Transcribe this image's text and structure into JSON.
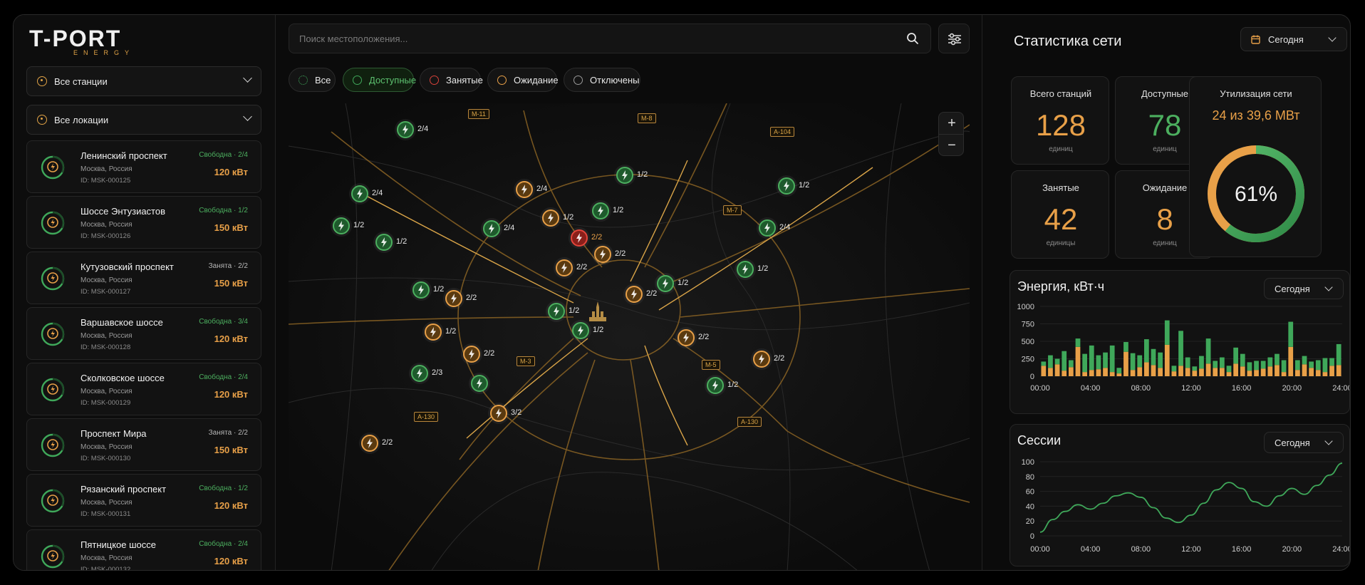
{
  "brand": {
    "name": "T-PORT",
    "sub": "ENERGY"
  },
  "filters": {
    "stations_dropdown": "Все станции",
    "locations_dropdown": "Все локации"
  },
  "stations": [
    {
      "name": "Ленинский проспект",
      "location": "Москва, Россия",
      "id": "ID: MSK-000125",
      "status": "Свободна · 2/4",
      "status_type": "free",
      "power": "120 кВт"
    },
    {
      "name": "Шоссе Энтузиастов",
      "location": "Москва, Россия",
      "id": "ID: MSK-000126",
      "status": "Свободна · 1/2",
      "status_type": "free",
      "power": "150 кВт"
    },
    {
      "name": "Кутузовский проспект",
      "location": "Москва, Россия",
      "id": "ID: MSK-000127",
      "status": "Занята · 2/2",
      "status_type": "busy",
      "power": "150 кВт"
    },
    {
      "name": "Варшавское шоссе",
      "location": "Москва, Россия",
      "id": "ID: MSK-000128",
      "status": "Свободна · 3/4",
      "status_type": "free",
      "power": "120 кВт"
    },
    {
      "name": "Сколковское шоссе",
      "location": "Москва, Россия",
      "id": "ID: MSK-000129",
      "status": "Свободна · 2/4",
      "status_type": "free",
      "power": "120 кВт"
    },
    {
      "name": "Проспект Мира",
      "location": "Москва, Россия",
      "id": "ID: MSK-000130",
      "status": "Занята · 2/2",
      "status_type": "busy",
      "power": "150 кВт"
    },
    {
      "name": "Рязанский проспект",
      "location": "Москва, Россия",
      "id": "ID: MSK-000131",
      "status": "Свободна · 1/2",
      "status_type": "free",
      "power": "120 кВт"
    },
    {
      "name": "Пятницкое шоссе",
      "location": "Москва, Россия",
      "id": "ID: MSK-000132",
      "status": "Свободна · 2/4",
      "status_type": "free",
      "power": "120 кВт"
    }
  ],
  "search": {
    "placeholder": "Поиск местоположения..."
  },
  "status_chips": [
    {
      "label": "Все",
      "color": "#3fa85a"
    },
    {
      "label": "Доступные",
      "color": "#3fa85a"
    },
    {
      "label": "Занятые",
      "color": "#d9423a"
    },
    {
      "label": "Ожидание",
      "color": "#e8a048"
    },
    {
      "label": "Отключены",
      "color": "#9a9a9a"
    }
  ],
  "map": {
    "zoom_in": "+",
    "zoom_out": "−",
    "roads": [
      "M-11",
      "M-8",
      "A-104",
      "M-7",
      "M-3",
      "M-5",
      "A-130",
      "A-130"
    ],
    "pins": [
      {
        "label": "2/4",
        "type": "free"
      },
      {
        "label": "2/4",
        "type": "free"
      },
      {
        "label": "1/2",
        "type": "free"
      },
      {
        "label": "1/2",
        "type": "free"
      },
      {
        "label": "2/4",
        "type": "busy"
      },
      {
        "label": "1/2",
        "type": "free"
      },
      {
        "label": "1/2",
        "type": "free"
      },
      {
        "label": "2/4",
        "type": "free"
      },
      {
        "label": "1/2",
        "type": "busy"
      },
      {
        "label": "1/2",
        "type": "free"
      },
      {
        "label": "2/4",
        "type": "free"
      },
      {
        "label": "2/2",
        "type": "red"
      },
      {
        "label": "2/2",
        "type": "busy"
      },
      {
        "label": "2/2",
        "type": "busy"
      },
      {
        "label": "1/2",
        "type": "free"
      },
      {
        "label": "1/2",
        "type": "free"
      },
      {
        "label": "2/2",
        "type": "busy"
      },
      {
        "label": "1/2",
        "type": "free"
      },
      {
        "label": "2/2",
        "type": "busy"
      },
      {
        "label": "1/2",
        "type": "free"
      },
      {
        "label": "1/2",
        "type": "free"
      },
      {
        "label": "1/2",
        "type": "busy"
      },
      {
        "label": "2/2",
        "type": "busy"
      },
      {
        "label": "2/2",
        "type": "busy"
      },
      {
        "label": "2/3",
        "type": "free"
      },
      {
        "label": "",
        "type": "free"
      },
      {
        "label": "1/2",
        "type": "free"
      },
      {
        "label": "2/2",
        "type": "busy"
      },
      {
        "label": "3/2",
        "type": "busy"
      },
      {
        "label": "2/2",
        "type": "busy"
      }
    ]
  },
  "stats": {
    "title": "Статистика сети",
    "period": "Сегодня",
    "kpis": [
      {
        "label": "Всего станций",
        "value": "128",
        "unit": "единиц",
        "color": "#e8a048"
      },
      {
        "label": "Доступные",
        "value": "78",
        "unit": "единиц",
        "color": "#4caf5f"
      },
      {
        "label": "Занятые",
        "value": "42",
        "unit": "единицы",
        "color": "#e8a048"
      },
      {
        "label": "Ожидание",
        "value": "8",
        "unit": "единиц",
        "color": "#e8a048"
      }
    ],
    "utilization": {
      "title": "Утилизация сети",
      "value": "24 из 39,6 МВт",
      "percent_label": "61%",
      "percent": 61
    }
  },
  "chart_data": [
    {
      "type": "bar",
      "title": "Энергия, кВт·ч",
      "period": "Сегодня",
      "ylim": [
        0,
        1000
      ],
      "yticks": [
        "1000",
        "750",
        "500",
        "250",
        "0"
      ],
      "xticks": [
        "00:00",
        "04:00",
        "08:00",
        "12:00",
        "16:00",
        "20:00",
        "24:00"
      ],
      "series": [
        {
          "color": "#e8a048",
          "values": [
            150,
            120,
            170,
            80,
            130,
            420,
            60,
            90,
            100,
            120,
            60,
            40,
            350,
            90,
            130,
            200,
            160,
            120,
            450,
            70,
            150,
            120,
            80,
            110,
            180,
            120,
            120,
            60,
            180,
            140,
            80,
            90,
            110,
            140,
            160,
            60,
            420,
            90,
            170,
            120,
            90,
            60,
            150,
            160
          ]
        },
        {
          "color": "#3fa85a",
          "values": [
            60,
            180,
            80,
            280,
            100,
            120,
            260,
            350,
            200,
            220,
            380,
            80,
            140,
            240,
            170,
            330,
            230,
            220,
            350,
            80,
            500,
            150,
            60,
            180,
            360,
            100,
            150,
            90,
            230,
            180,
            120,
            130,
            110,
            130,
            160,
            170,
            360,
            140,
            120,
            90,
            140,
            200,
            110,
            300
          ]
        }
      ]
    },
    {
      "type": "line",
      "title": "Сессии",
      "period": "Сегодня",
      "ylim": [
        0,
        100
      ],
      "yticks": [
        "100",
        "80",
        "60",
        "40",
        "20",
        "0"
      ],
      "xticks": [
        "00:00",
        "04:00",
        "08:00",
        "12:00",
        "16:00",
        "20:00",
        "24:00"
      ],
      "x": [
        0,
        1,
        2,
        3,
        4,
        5,
        6,
        7,
        8,
        9,
        10,
        11,
        12,
        13,
        14,
        15,
        16,
        17,
        18,
        19,
        20,
        21,
        22,
        23,
        24
      ],
      "values": [
        5,
        22,
        33,
        42,
        36,
        44,
        54,
        58,
        52,
        38,
        24,
        18,
        28,
        44,
        62,
        72,
        64,
        46,
        40,
        54,
        64,
        56,
        68,
        82,
        98
      ],
      "color": "#3fa85a"
    }
  ]
}
